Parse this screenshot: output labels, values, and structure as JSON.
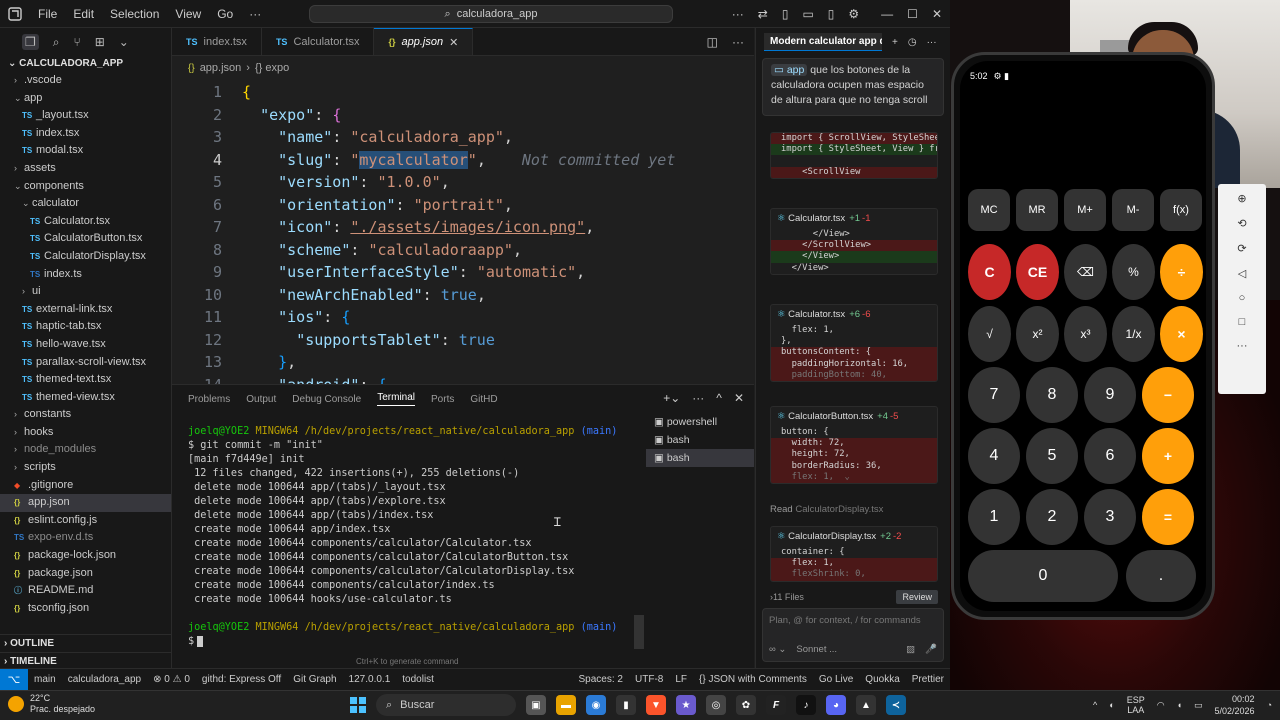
{
  "titlebar": {
    "menus": [
      "File",
      "Edit",
      "Selection",
      "View",
      "Go",
      "···"
    ],
    "search": "calculadora_app"
  },
  "explorer": {
    "root": "CALCULADORA_APP",
    "items": [
      {
        "label": ".vscode",
        "type": "folder",
        "depth": 1,
        "open": false
      },
      {
        "label": "app",
        "type": "folder",
        "depth": 1,
        "open": true
      },
      {
        "label": "_layout.tsx",
        "type": "tsx",
        "depth": 2
      },
      {
        "label": "index.tsx",
        "type": "tsx",
        "depth": 2
      },
      {
        "label": "modal.tsx",
        "type": "tsx",
        "depth": 2
      },
      {
        "label": "assets",
        "type": "folder",
        "depth": 1,
        "open": false
      },
      {
        "label": "components",
        "type": "folder",
        "depth": 1,
        "open": true
      },
      {
        "label": "calculator",
        "type": "folder",
        "depth": 2,
        "open": true
      },
      {
        "label": "Calculator.tsx",
        "type": "tsx",
        "depth": 3
      },
      {
        "label": "CalculatorButton.tsx",
        "type": "tsx",
        "depth": 3
      },
      {
        "label": "CalculatorDisplay.tsx",
        "type": "tsx",
        "depth": 3
      },
      {
        "label": "index.ts",
        "type": "ts",
        "depth": 3
      },
      {
        "label": "ui",
        "type": "folder",
        "depth": 2,
        "open": false
      },
      {
        "label": "external-link.tsx",
        "type": "tsx",
        "depth": 2
      },
      {
        "label": "haptic-tab.tsx",
        "type": "tsx",
        "depth": 2
      },
      {
        "label": "hello-wave.tsx",
        "type": "tsx",
        "depth": 2
      },
      {
        "label": "parallax-scroll-view.tsx",
        "type": "tsx",
        "depth": 2
      },
      {
        "label": "themed-text.tsx",
        "type": "tsx",
        "depth": 2
      },
      {
        "label": "themed-view.tsx",
        "type": "tsx",
        "depth": 2
      },
      {
        "label": "constants",
        "type": "folder",
        "depth": 1,
        "open": false
      },
      {
        "label": "hooks",
        "type": "folder",
        "depth": 1,
        "open": false
      },
      {
        "label": "node_modules",
        "type": "folder",
        "depth": 1,
        "open": false,
        "dim": true
      },
      {
        "label": "scripts",
        "type": "folder",
        "depth": 1,
        "open": false
      },
      {
        "label": ".gitignore",
        "type": "git",
        "depth": 1
      },
      {
        "label": "app.json",
        "type": "json",
        "depth": 1,
        "selected": true
      },
      {
        "label": "eslint.config.js",
        "type": "json",
        "depth": 1
      },
      {
        "label": "expo-env.d.ts",
        "type": "ts",
        "depth": 1,
        "dim": true
      },
      {
        "label": "package-lock.json",
        "type": "json",
        "depth": 1
      },
      {
        "label": "package.json",
        "type": "json",
        "depth": 1
      },
      {
        "label": "README.md",
        "type": "md",
        "depth": 1
      },
      {
        "label": "tsconfig.json",
        "type": "json",
        "depth": 1
      }
    ],
    "outline": "OUTLINE",
    "timeline": "TIMELINE"
  },
  "tabs": [
    {
      "label": "index.tsx",
      "icon": "TS",
      "active": false
    },
    {
      "label": "Calculator.tsx",
      "icon": "TS",
      "active": false
    },
    {
      "label": "app.json",
      "icon": "{}",
      "active": true
    }
  ],
  "breadcrumb": {
    "file": "app.json",
    "symbol": "{} expo"
  },
  "editor": {
    "current_line": 4,
    "ghost_text": "Not committed yet",
    "lines": [
      "1",
      "2",
      "3",
      "4",
      "5",
      "6",
      "7",
      "8",
      "9",
      "10",
      "11",
      "12",
      "13",
      "14"
    ]
  },
  "panel": {
    "tabs": [
      "Problems",
      "Output",
      "Debug Console",
      "Terminal",
      "Ports",
      "GitHD"
    ],
    "active_tab": "Terminal",
    "terminals": [
      "powershell",
      "bash",
      "bash"
    ],
    "hint": "Ctrl+K to generate command",
    "prompt_user": "joelq@YOE2",
    "prompt_env": "MINGW64",
    "prompt_path": "/h/dev/projects/react_native/calculadora_app",
    "prompt_branch": "(main)",
    "command": "$ git commit -m \"init\"",
    "output": [
      "[main f7d449e] init",
      " 12 files changed, 422 insertions(+), 255 deletions(-)",
      " delete mode 100644 app/(tabs)/_layout.tsx",
      " delete mode 100644 app/(tabs)/explore.tsx",
      " delete mode 100644 app/(tabs)/index.tsx",
      " create mode 100644 app/index.tsx",
      " create mode 100644 components/calculator/Calculator.tsx",
      " create mode 100644 components/calculator/CalculatorButton.tsx",
      " create mode 100644 components/calculator/CalculatorDisplay.tsx",
      " create mode 100644 components/calculator/index.ts",
      " create mode 100644 hooks/use-calculator.ts"
    ],
    "final_prompt": "$"
  },
  "chat": {
    "title": "Modern calculator app de",
    "prompt_chip": "app",
    "prompt_text": "que los botones de la calculadora ocupen mas espacio de altura para que no tenga scroll",
    "top_snippet": [
      {
        "text": "import { ScrollView, StyleShee",
        "kind": "del"
      },
      {
        "text": "import { StyleSheet, View } fr",
        "kind": "add"
      },
      {
        "text": "",
        "kind": "ctx"
      },
      {
        "text": "    <ScrollView",
        "kind": "del"
      }
    ],
    "cards": [
      {
        "file": "Calculator.tsx",
        "plus": "+1",
        "minus": "-1",
        "lines": [
          {
            "text": "      </View>",
            "kind": "ctx"
          },
          {
            "text": "    </ScrollView>",
            "kind": "del"
          },
          {
            "text": "    </View>",
            "kind": "add"
          },
          {
            "text": "  </View>",
            "kind": "ctx"
          }
        ]
      },
      {
        "file": "Calculator.tsx",
        "plus": "+6",
        "minus": "-6",
        "lines": [
          {
            "text": "  flex: 1,",
            "kind": "ctx"
          },
          {
            "text": "},",
            "kind": "ctx"
          },
          {
            "text": "buttonsContent: {",
            "kind": "del"
          },
          {
            "text": "  paddingHorizontal: 16,",
            "kind": "del"
          },
          {
            "text": "  paddingBottom: 40,",
            "kind": "dim"
          }
        ]
      },
      {
        "file": "CalculatorButton.tsx",
        "plus": "+4",
        "minus": "-5",
        "lines": [
          {
            "text": "button: {",
            "kind": "ctx"
          },
          {
            "text": "  width: 72,",
            "kind": "del"
          },
          {
            "text": "  height: 72,",
            "kind": "del"
          },
          {
            "text": "  borderRadius: 36,",
            "kind": "del"
          },
          {
            "text": "  flex: 1,  ⌄",
            "kind": "dim"
          }
        ]
      },
      {
        "file": "CalculatorDisplay.tsx",
        "plus": "+2",
        "minus": "-2",
        "lines": [
          {
            "text": "container: {",
            "kind": "ctx"
          },
          {
            "text": "  flex: 1,",
            "kind": "del"
          },
          {
            "text": "  flexShrink: 0,",
            "kind": "dim"
          }
        ]
      }
    ],
    "read_label": "Read",
    "read_file": "CalculatorDisplay.tsx",
    "files_count": "11 Files",
    "review": "Review",
    "input_placeholder": "Plan, @ for context, / for commands",
    "model": "Sonnet ..."
  },
  "statusbar": {
    "items": [
      "main",
      "calculadora_app",
      "⊗ 0 ⚠ 0",
      "githd: Express Off",
      "Git Graph",
      "127.0.0.1",
      "todolist",
      "Spaces: 2",
      "UTF-8",
      "LF",
      "{} JSON with Comments",
      "Go Live",
      "Quokka",
      "Prettier"
    ]
  },
  "phone": {
    "time": "5:02",
    "keys": {
      "fn": [
        "MC",
        "MR",
        "M+",
        "M-",
        "f(x)"
      ],
      "row1": [
        "C",
        "CE",
        "⌫",
        "%",
        "÷"
      ],
      "row2": [
        "√",
        "x²",
        "x³",
        "1/x",
        "×"
      ],
      "row3": [
        "7",
        "8",
        "9",
        "−"
      ],
      "row4": [
        "4",
        "5",
        "6",
        "+"
      ],
      "row5": [
        "1",
        "2",
        "3",
        "="
      ],
      "row6": [
        "0",
        "."
      ]
    }
  },
  "taskbar": {
    "temp": "22°C",
    "weather": "Prac. despejado",
    "search": "Buscar",
    "lang1": "ESP",
    "lang2": "LAA",
    "time": "00:02",
    "date": "5/02/2026"
  },
  "colors": {
    "accent": "#0078d4",
    "orange": "#ff9f0a",
    "red_key": "#c62828",
    "key_gray": "#333333"
  }
}
